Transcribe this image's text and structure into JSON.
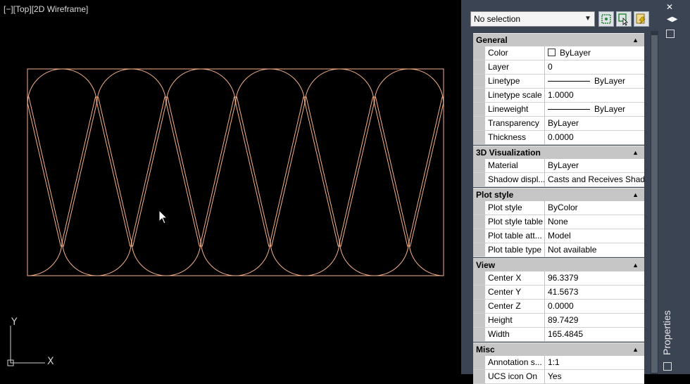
{
  "viewport": {
    "label": "[−][Top][2D Wireframe]",
    "ucs_y": "Y",
    "ucs_x": "X",
    "drawing_color": "#f5b08a"
  },
  "properties_panel": {
    "selection": "No selection",
    "title": "Properties",
    "categories": [
      {
        "name": "General",
        "rows": [
          {
            "name": "Color",
            "value": "ByLayer"
          },
          {
            "name": "Layer",
            "value": "0"
          },
          {
            "name": "Linetype",
            "value": "ByLayer"
          },
          {
            "name": "Linetype scale",
            "value": "1.0000"
          },
          {
            "name": "Lineweight",
            "value": "ByLayer"
          },
          {
            "name": "Transparency",
            "value": "ByLayer"
          },
          {
            "name": "Thickness",
            "value": "0.0000"
          }
        ]
      },
      {
        "name": "3D Visualization",
        "rows": [
          {
            "name": "Material",
            "value": "ByLayer"
          },
          {
            "name": "Shadow displ...",
            "value": "Casts and Receives Shad..."
          }
        ]
      },
      {
        "name": "Plot style",
        "rows": [
          {
            "name": "Plot style",
            "value": "ByColor"
          },
          {
            "name": "Plot style table",
            "value": "None"
          },
          {
            "name": "Plot table att...",
            "value": "Model"
          },
          {
            "name": "Plot table type",
            "value": "Not available"
          }
        ]
      },
      {
        "name": "View",
        "rows": [
          {
            "name": "Center X",
            "value": "96.3379"
          },
          {
            "name": "Center Y",
            "value": "41.5673"
          },
          {
            "name": "Center Z",
            "value": "0.0000"
          },
          {
            "name": "Height",
            "value": "89.7429"
          },
          {
            "name": "Width",
            "value": "165.4845"
          }
        ]
      },
      {
        "name": "Misc",
        "rows": [
          {
            "name": "Annotation s...",
            "value": "1:1"
          },
          {
            "name": "UCS icon On",
            "value": "Yes"
          }
        ]
      }
    ]
  }
}
